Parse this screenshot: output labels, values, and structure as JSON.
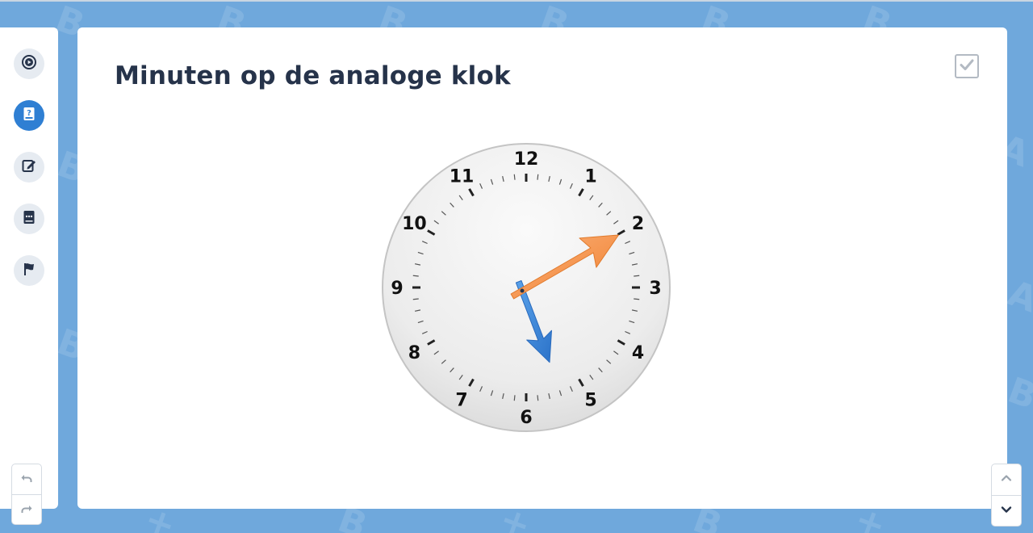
{
  "page": {
    "title": "Minuten op de analoge klok"
  },
  "sidebar": {
    "items": [
      {
        "name": "instruction",
        "icon": "play-circle-icon",
        "active": false
      },
      {
        "name": "question",
        "icon": "question-book-icon",
        "active": true
      },
      {
        "name": "exercise",
        "icon": "pencil-edit-icon",
        "active": false
      },
      {
        "name": "feedback",
        "icon": "chat-book-icon",
        "active": false
      },
      {
        "name": "finish",
        "icon": "flag-icon",
        "active": false
      }
    ],
    "history": [
      {
        "name": "undo",
        "icon": "undo-arrow-icon"
      },
      {
        "name": "redo",
        "icon": "redo-arrow-icon"
      }
    ]
  },
  "check": {
    "icon": "checkmark-icon"
  },
  "clock": {
    "numbers": [
      "12",
      "1",
      "2",
      "3",
      "4",
      "5",
      "6",
      "7",
      "8",
      "9",
      "10",
      "11"
    ],
    "hour_hand": {
      "points_to_minute": 26.5,
      "color": "#3a86d8"
    },
    "minute_hand": {
      "points_to_minute": 10,
      "color": "#f28a3a"
    }
  },
  "scroll": [
    {
      "name": "scroll-up",
      "icon": "chevron-up-icon"
    },
    {
      "name": "scroll-down",
      "icon": "chevron-down-icon"
    }
  ],
  "colors": {
    "background": "#6fa8dc",
    "accent": "#2f7fd3",
    "title": "#26334a"
  }
}
